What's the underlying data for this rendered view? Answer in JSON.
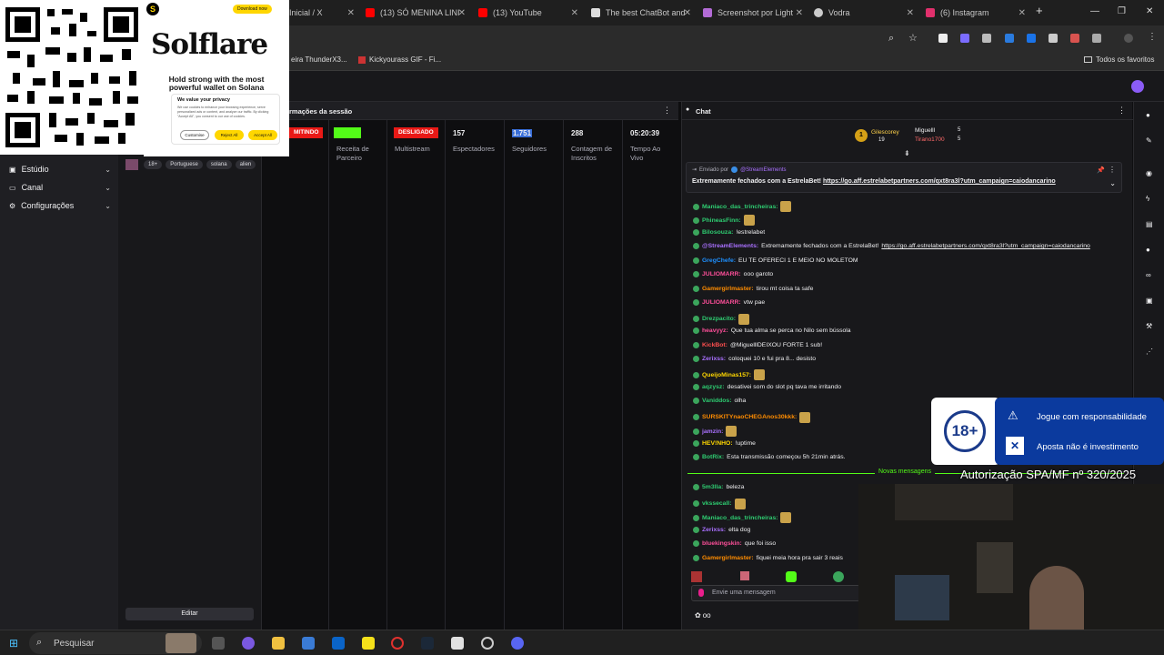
{
  "browser": {
    "tabs": [
      {
        "label": "Inicial / X"
      },
      {
        "label": "(13) SÓ MENINA LINI"
      },
      {
        "label": "(13) YouTube"
      },
      {
        "label": "The best ChatBot and"
      },
      {
        "label": "Screenshot por Light"
      },
      {
        "label": "Vodra"
      },
      {
        "label": "(6) Instagram"
      }
    ],
    "bookmarks": [
      {
        "label": "eira ThunderX3..."
      },
      {
        "label": "Kickyourass GIF - Fi..."
      }
    ],
    "favorites_label": "Todos os favoritos"
  },
  "ad": {
    "download_label": "Download now",
    "brand": "Solflare",
    "headline": "Hold strong with the most powerful wallet on Solana",
    "privacy_title": "We value your privacy",
    "privacy_body": "We use cookies to enhance your browsing experience, serve personalized ads or content, and analyze our traffic. By clicking \"Accept All\", you consent to our use of cookies.",
    "customise": "Customise",
    "reject": "Reject All",
    "accept": "Accept All"
  },
  "left_nav": {
    "items": [
      {
        "label": "Estúdio"
      },
      {
        "label": "Canal"
      },
      {
        "label": "Configurações"
      }
    ]
  },
  "stream_info": {
    "tags": [
      "18+",
      "Portuguese",
      "solana",
      "alien"
    ],
    "edit_label": "Editar"
  },
  "session": {
    "title": "rmações da sessão",
    "stats": [
      {
        "value": "MITINDO",
        "label": ""
      },
      {
        "value": "",
        "label": "Receita de Parceiro"
      },
      {
        "value": "DESLIGADO",
        "label": "Multistream"
      },
      {
        "value": "157",
        "label": "Espectadores"
      },
      {
        "value": "1.751",
        "label": "Seguidores"
      },
      {
        "value": "288",
        "label": "Contagem de Inscritos"
      },
      {
        "value": "05:20:39",
        "label": "Tempo Ao Vivo"
      }
    ]
  },
  "chat": {
    "title": "Chat",
    "leaders": [
      {
        "name": "Gilescorey",
        "count": "19"
      },
      {
        "name": "Miguelll",
        "count": "5"
      },
      {
        "name": "Tirano1700",
        "count": "5"
      }
    ],
    "pinned": {
      "sent_by": "Enviado por",
      "sender": "@StreamElements",
      "text": "Extremamente fechados com a EstrelaBet!",
      "link": "https://go.aff.estrelabetpartners.com/qxt8ra3l?utm_campaign=caiodancarino"
    },
    "messages": [
      {
        "user": "Maniaco_das_trincheiras",
        "text": "",
        "color": "#2ecc71"
      },
      {
        "user": "PhineasFinn",
        "text": "",
        "color": "#2ecc71"
      },
      {
        "user": "Bilosouza",
        "text": "!estrelabet",
        "color": "#2ecc71"
      },
      {
        "user": "@StreamElements",
        "text": "Extremamente fechados com a EstrelaBet!",
        "link": "https://go.aff.estrelabetpartners.com/qxt8ra3l?utm_campaign=caiodancarino",
        "color": "#a970ff"
      },
      {
        "user": "GregChefe",
        "text": "EU TE OFERECI 1 E MEIO NO MOLETOM",
        "color": "#1e90ff"
      },
      {
        "user": "JULIOMARR",
        "text": "ooo garoto",
        "color": "#ff4f9a"
      },
      {
        "user": "Gamergirlmaster",
        "text": "tirou mt coisa ta safe",
        "color": "#ff8c00"
      },
      {
        "user": "JULIOMARR",
        "text": "vtw pae",
        "color": "#ff4f9a"
      },
      {
        "user": "Drezpacito",
        "text": "",
        "color": "#2ecc71"
      },
      {
        "user": "heavyyz",
        "text": "Que tua alma se perca no Nilo sem bússola",
        "color": "#ff4f9a"
      },
      {
        "user": "KickBot",
        "text": "@MiguelllDEIXOU FORTE 1 sub!",
        "color": "#ff4f4f"
      },
      {
        "user": "Zerixss",
        "text": "coloquei 10 e fui pra 8... desisto",
        "color": "#a970ff"
      },
      {
        "user": "QueijoMinas157",
        "text": "",
        "color": "#ffd700"
      },
      {
        "user": "aqzysz",
        "text": "desativei som do slot pq tava me irritando",
        "color": "#2ecc71"
      },
      {
        "user": "Vaniddos",
        "text": "olha",
        "color": "#2ecc71"
      },
      {
        "user": "SURSKITYnaoCHEGAnos30kkk",
        "text": "",
        "color": "#ff8c00"
      },
      {
        "user": "jamzin",
        "text": "",
        "color": "#a970ff"
      },
      {
        "user": "HEV!NHO",
        "text": "!uptime",
        "color": "#ffd700"
      },
      {
        "user": "BotRix",
        "text": "Esta transmissão começou 5h 21min atrás.",
        "color": "#2ecc71"
      }
    ],
    "new_messages_label": "Novas mensagens",
    "messages_after": [
      {
        "user": "5m3lla",
        "text": "beleza",
        "color": "#2ecc71"
      },
      {
        "user": "vkssecall",
        "text": "",
        "color": "#2ecc71"
      },
      {
        "user": "Maniaco_das_trincheiras",
        "text": "",
        "color": "#2ecc71"
      },
      {
        "user": "Zerixss",
        "text": "elta dog",
        "color": "#a970ff"
      },
      {
        "user": "bluekingskin",
        "text": "que foi isso",
        "color": "#ff4f9a"
      },
      {
        "user": "Gamergirlmaster",
        "text": "fiquei meia hora pra sair 3 reais",
        "color": "#ff8c00"
      }
    ],
    "input_placeholder": "Envie uma mensagem",
    "footer": "oo"
  },
  "overlay": {
    "age": "18+",
    "line1": "Jogue com responsabilidade",
    "line2": "Aposta não é investimento",
    "auth": "Autorização SPA/MF nº 320/2025"
  },
  "taskbar": {
    "search_placeholder": "Pesquisar"
  }
}
